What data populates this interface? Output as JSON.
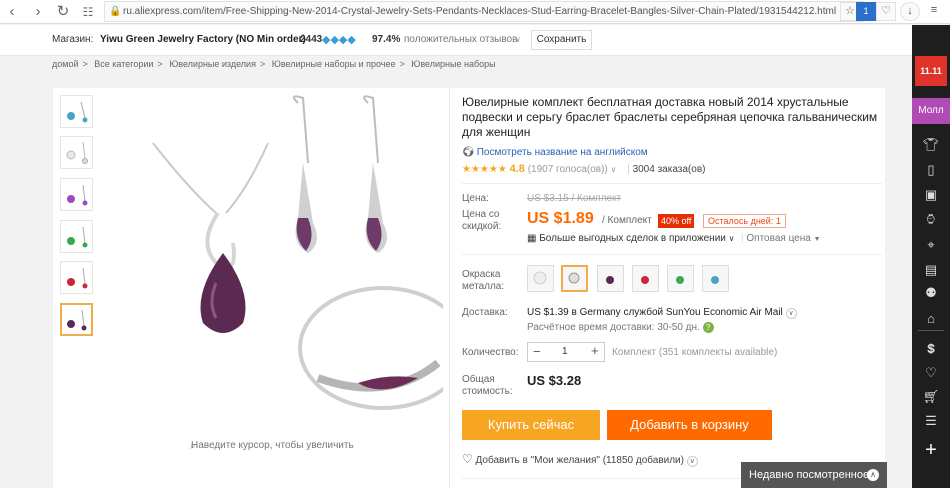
{
  "browser": {
    "url": "ru.aliexpress.com/item/Free-Shipping-New-2014-Crystal-Jewelry-Sets-Pendants-Necklaces-Stud-Earring-Bracelet-Bangles-Silver-Chain-Plated/1931544212.html",
    "shield_badge": "1"
  },
  "store": {
    "label": "Магазин:",
    "name": "Yiwu Green Jewelry Factory (NO Min order)",
    "score": "2443",
    "positive": "97.4%",
    "positive_label": "положительных отзывов",
    "save_label": "Сохранить"
  },
  "breadcrumbs": [
    "домой",
    "Все категории",
    "Ювелирные изделия",
    "Ювелирные наборы и прочее",
    "Ювелирные наборы"
  ],
  "gallery": {
    "hint": "Наведите курсор, чтобы увеличить"
  },
  "product": {
    "title": "Ювелирные комплект бесплатная доставка новый 2014 хрустальные подвески и серьгу браслет браслеты серебряная цепочка гальваническим для женщин",
    "translate_link": "Посмотреть название на английском",
    "rating": "4.8",
    "votes": "(1907 голоса(ов))",
    "orders": "3004 заказа(ов)"
  },
  "price": {
    "label": "Цена:",
    "old": "US $3.15 / Комплект",
    "discount_label": "Цена со скидкой:",
    "current": "US $1.89",
    "unit": "/ Комплект",
    "off_badge": "40% off",
    "days_left": "Осталось дней: 1",
    "app_deals": "Больше выгодных сделок в приложении",
    "wholesale": "Оптовая цена"
  },
  "options": {
    "color_label": "Окраска металла:",
    "shipping_label": "Доставка:",
    "shipping_text": "US $1.39 в Germany службой SunYou Economic Air Mail",
    "delivery_time": "Расчётное время доставки: 30-50 дн.",
    "qty_label": "Количество:",
    "qty_value": "1",
    "qty_available": "Комплект (351 комплекты available)",
    "total_label": "Общая стоимость:",
    "total_value": "US $3.28"
  },
  "actions": {
    "buy_now": "Купить сейчас",
    "add_to_cart": "Добавить в корзину",
    "wishlist": "Добавить в \"Мои желания\" (11850 добавили)",
    "recently_viewed": "Недавно посмотренное"
  },
  "sidebar": {
    "promo_text": "11.11",
    "mall_label": "Молл"
  },
  "colors": {
    "orange": "#ff6a00",
    "buy_orange": "#f6a623",
    "badge_red": "#e62e04",
    "link_blue": "#2a63b5"
  }
}
